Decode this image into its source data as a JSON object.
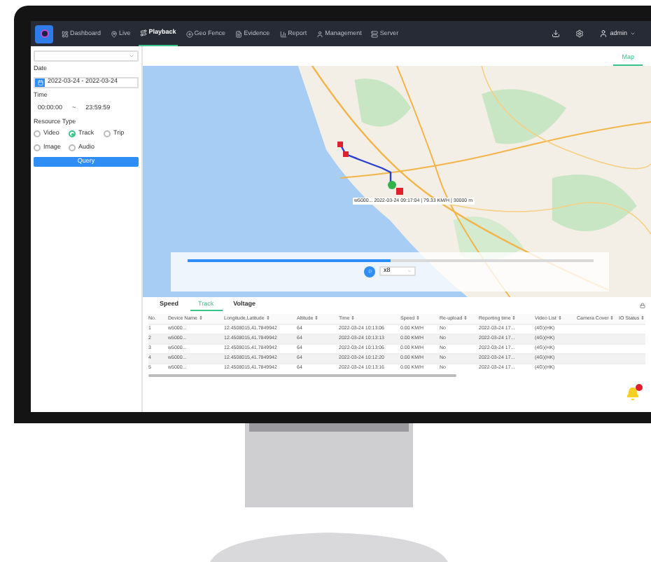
{
  "nav": {
    "items": [
      {
        "label": "Dashboard",
        "selected": false
      },
      {
        "label": "Live",
        "selected": false
      },
      {
        "label": "Playback",
        "selected": true
      },
      {
        "label": "Geo Fence",
        "selected": false
      },
      {
        "label": "Evidence",
        "selected": false
      },
      {
        "label": "Report",
        "selected": false
      },
      {
        "label": "Management",
        "selected": false
      },
      {
        "label": "Server",
        "selected": false
      }
    ],
    "user": "admin"
  },
  "sidebar": {
    "date_label": "Date",
    "date_range": "2022-03-24 - 2022-03-24",
    "time_label": "Time",
    "time_start": "00:00:00",
    "time_separator": "~",
    "time_end": "23:59:59",
    "resource_label": "Resource Type",
    "resources": [
      {
        "label": "Video",
        "selected": false
      },
      {
        "label": "Track",
        "selected": true
      },
      {
        "label": "Trip",
        "selected": false
      },
      {
        "label": "Image",
        "selected": false
      },
      {
        "label": "Audio",
        "selected": false
      }
    ],
    "query_button": "Query"
  },
  "view_tabs": [
    {
      "label": "Map",
      "selected": true
    }
  ],
  "map": {
    "tooltip": "w5000... 2022-03-24 09:17:04 | 79.33 KM/H | 30000 m"
  },
  "playback": {
    "level": 0.5,
    "speed": "x8"
  },
  "data_tabs": [
    {
      "label": "Speed",
      "selected": false
    },
    {
      "label": "Track",
      "selected": true
    },
    {
      "label": "Voltage",
      "selected": false
    }
  ],
  "table": {
    "columns": [
      "No.",
      "Device Name ⇕",
      "Longitude,Latitude ⇕",
      "Altitude ⇕",
      "Time ⇕",
      "Speed ⇕",
      "Re-upload ⇕",
      "Reporting time ⇕",
      "Video List ⇕",
      "Camera Cover ⇕",
      "IO Status ⇕"
    ],
    "rows": [
      [
        "1",
        "w5000...",
        "12.4508015,41.7849942",
        "64",
        "2022-03-24 10:13:06",
        "0.00 KM/H",
        "No",
        "2022-03-24 17...",
        "(4G)(HK)",
        "",
        ""
      ],
      [
        "2",
        "w5000...",
        "12.4508015,41.7849942",
        "64",
        "2022-03-24 10:13:13",
        "0.00 KM/H",
        "No",
        "2022-03-24 17...",
        "(4G)(HK)",
        "",
        ""
      ],
      [
        "3",
        "w5000...",
        "12.4508015,41.7849942",
        "64",
        "2022-03-24 10:13:06",
        "0.00 KM/H",
        "No",
        "2022-03-24 17...",
        "(4G)(HK)",
        "",
        ""
      ],
      [
        "4",
        "w5000...",
        "12.4508015,41.7849942",
        "64",
        "2022-03-24 10:12:20",
        "0.00 KM/H",
        "No",
        "2022-03-24 17...",
        "(4G)(HK)",
        "",
        ""
      ],
      [
        "5",
        "w5000...",
        "12.4508015,41.7849942",
        "64",
        "2022-03-24 10:13:16",
        "0.00 KM/H",
        "No",
        "2022-03-24 17...",
        "(4G)(HK)",
        "",
        ""
      ]
    ]
  }
}
